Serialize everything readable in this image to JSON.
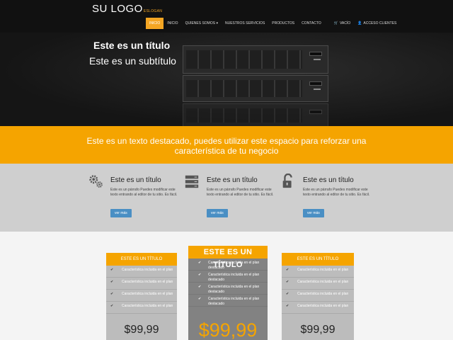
{
  "header": {
    "logo": "SU LOGO",
    "logo_tagline": "ESLOGAN",
    "nav": [
      {
        "label": "INICIO",
        "icon": ""
      },
      {
        "label": "INICIO",
        "icon": ""
      },
      {
        "label": "QUIENES SOMOS ▾",
        "icon": ""
      },
      {
        "label": "NUESTROS SERVICIOS",
        "icon": ""
      },
      {
        "label": "PRODUCTOS",
        "icon": ""
      },
      {
        "label": "CONTACTO",
        "icon": ""
      },
      {
        "label": "VACÍO",
        "icon": "cart-icon"
      },
      {
        "label": "ACCESO CLIENTES",
        "icon": "user-icon"
      }
    ]
  },
  "hero": {
    "title": "Este es un título",
    "subtitle": "Este es un subtítulo"
  },
  "band": {
    "text": "Este es un texto destacado, puedes utilizar este espacio para reforzar una característica de tu negocio"
  },
  "features": [
    {
      "icon": "gears-icon",
      "title": "Este es un título",
      "text": "Este es un párrafo Puedes modificar este texto entrando al editor de tu sitio. Es fácil.",
      "button": "ver más"
    },
    {
      "icon": "server-list-icon",
      "title": "Este es un título",
      "text": "Este es un párrafo Puedes modificar este texto entrando al editor de tu sitio. Es fácil.",
      "button": "ver más"
    },
    {
      "icon": "unlock-icon",
      "title": "Este es un título",
      "text": "Este es un párrafo Puedes modificar este texto entrando al editor de tu sitio. Es fácil.",
      "button": "ver más"
    }
  ],
  "plans": [
    {
      "title": "ESTE ES UN TÍTULO",
      "features": [
        "Característica incluida en el plan",
        "Característica incluida en el plan",
        "Característica incluida en el plan",
        "Característica incluida en el plan"
      ],
      "price": "$99,99"
    },
    {
      "title": "ESTE ES UN TÍTULO",
      "features": [
        "Característica incluida en el plan destacado",
        "Característica incluida en el plan destacado",
        "Característica incluida en el plan destacado",
        "Característica incluida en el plan destacado"
      ],
      "price": "$99,99"
    },
    {
      "title": "ESTE ES UN TÍTULO",
      "features": [
        "Característica incluida en el plan",
        "Característica incluida en el plan",
        "Característica incluida en el plan",
        "Característica incluida en el plan"
      ],
      "price": "$99,99"
    }
  ],
  "colors": {
    "accent": "#f5a400",
    "header": "#111111",
    "button": "#4a8fc4"
  }
}
